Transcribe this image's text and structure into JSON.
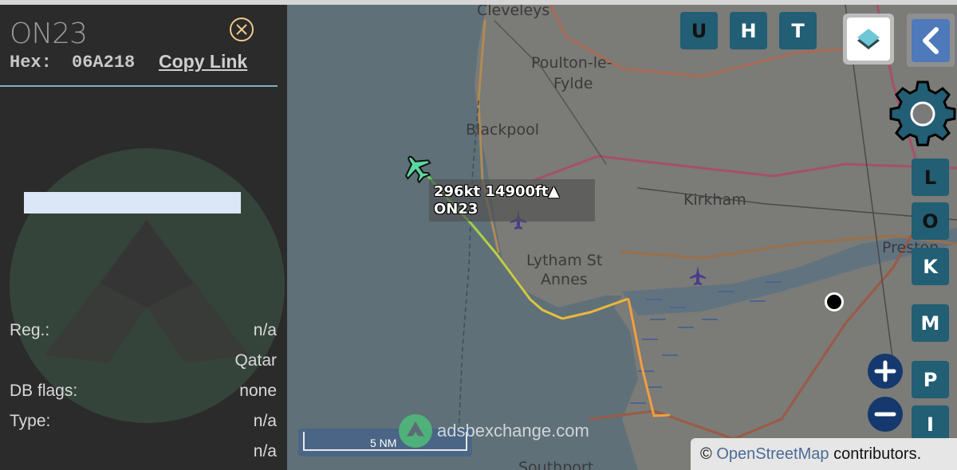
{
  "sidebar": {
    "callsign": "ON23",
    "hex_label": "Hex:",
    "hex_value": "06A218",
    "copy_link": "Copy Link",
    "close_icon": "close-circle-icon",
    "rows": [
      {
        "label": "Reg.:",
        "value": "n/a"
      },
      {
        "label": "",
        "value": "Qatar"
      },
      {
        "label": "DB flags:",
        "value": "none"
      },
      {
        "label": "Type:",
        "value": "n/a"
      },
      {
        "label": "",
        "value": "n/a"
      }
    ]
  },
  "map": {
    "places": [
      {
        "name": "Cleveleys"
      },
      {
        "name": "Poulton-le-"
      },
      {
        "name": "Fylde"
      },
      {
        "name": "Blackpool"
      },
      {
        "name": "Kirkham"
      },
      {
        "name": "Lytham St"
      },
      {
        "name": "Annes"
      },
      {
        "name": "Preston"
      },
      {
        "name": "Southport"
      }
    ],
    "aircraft_label": {
      "line1": "296kt 14900ft▲",
      "line2": "ON23"
    },
    "toolbar_top": [
      {
        "key": "U"
      },
      {
        "key": "H"
      },
      {
        "key": "T"
      }
    ],
    "toolbar_side": [
      {
        "key": "L"
      },
      {
        "key": "O"
      },
      {
        "key": "K"
      },
      {
        "key": "M"
      },
      {
        "key": "P"
      },
      {
        "key": "I"
      }
    ],
    "scale_label": "5 NM",
    "watermark": "adsbexchange.com",
    "attribution": {
      "symbol": "©",
      "link": "OpenStreetMap",
      "suffix": " contributors."
    },
    "colors": {
      "sea": "#5f7079",
      "land": "#7b7b7b",
      "track_green": "#5fd35f",
      "track_yellow": "#e8c23a",
      "track_orange": "#f0a040",
      "aircraft": "#5ad8a0",
      "button": "#225e74"
    }
  }
}
